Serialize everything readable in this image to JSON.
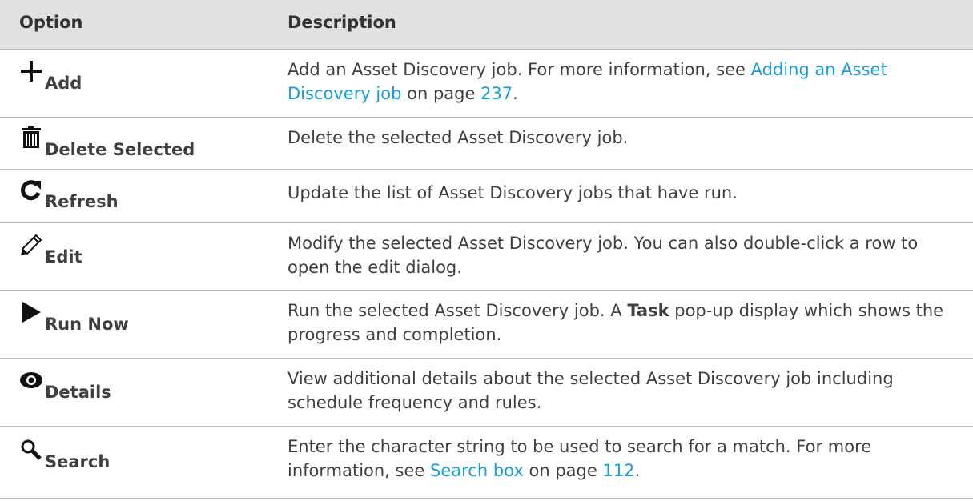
{
  "header": {
    "option": "Option",
    "description": "Description"
  },
  "rows": [
    {
      "label": "Add",
      "icon": "plus-icon",
      "desc_a": "Add an Asset Discovery job. For more information, see ",
      "link": "Adding an Asset Discovery job",
      "desc_b": " on page ",
      "page": "237",
      "desc_c": "."
    },
    {
      "label": "Delete Selected",
      "icon": "trash-icon",
      "desc": "Delete the selected Asset Discovery job."
    },
    {
      "label": "Refresh",
      "icon": "refresh-icon",
      "desc": "Update the list of Asset Discovery jobs that have run."
    },
    {
      "label": "Edit",
      "icon": "pencil-icon",
      "desc": "Modify the selected Asset Discovery job. You can also double-click a row to open the edit dialog."
    },
    {
      "label": "Run Now",
      "icon": "play-icon",
      "desc_a": "Run the selected Asset Discovery job. A ",
      "bold": "Task",
      "desc_b": " pop-up display which shows the progress and completion."
    },
    {
      "label": "Details",
      "icon": "eye-icon",
      "desc": "View additional details about the selected Asset Discovery job including schedule frequency and rules."
    },
    {
      "label": "Search",
      "icon": "magnifier-icon",
      "desc_a": "Enter the character string to be used to search for a match. For more information, see ",
      "link": "Search box",
      "desc_b": " on page ",
      "page": "112",
      "desc_c": "."
    }
  ],
  "colors": {
    "link": "#1a9ed9",
    "header_bg": "#e1e1e1",
    "text": "#3f3f3f",
    "divider": "#bdbdbd"
  }
}
